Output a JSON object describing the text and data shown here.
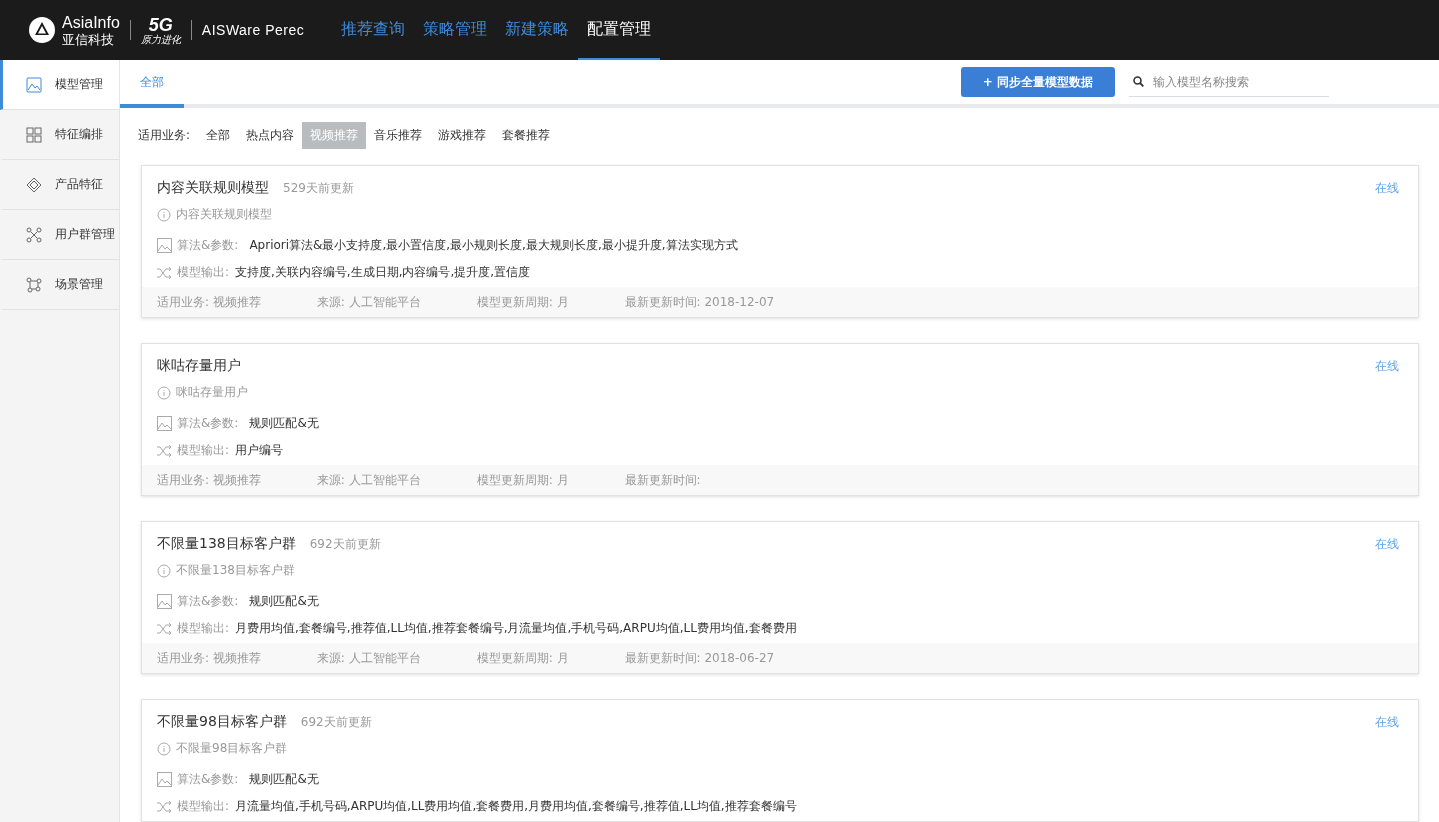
{
  "header": {
    "logo": {
      "brand": "AsiaInfo",
      "brand_cn": "亚信科技",
      "badge": "5G",
      "badge_sub": "原力进化",
      "product": "AISWare Perec"
    },
    "nav": [
      {
        "label": "推荐查询",
        "selected": false
      },
      {
        "label": "策略管理",
        "selected": false
      },
      {
        "label": "新建策略",
        "selected": false
      },
      {
        "label": "配置管理",
        "selected": true
      }
    ]
  },
  "sidebar": {
    "items": [
      {
        "label": "模型管理",
        "selected": true
      },
      {
        "label": "特征编排",
        "selected": false
      },
      {
        "label": "产品特征",
        "selected": false
      },
      {
        "label": "用户群管理",
        "selected": false
      },
      {
        "label": "场景管理",
        "selected": false
      }
    ]
  },
  "tabs": [
    {
      "label": "全部",
      "selected": true
    }
  ],
  "sync_button": "+ 同步全量模型数据",
  "search": {
    "placeholder": "输入模型名称搜索"
  },
  "filter": {
    "label": "适用业务:",
    "options": [
      {
        "label": "全部",
        "selected": false
      },
      {
        "label": "热点内容",
        "selected": false
      },
      {
        "label": "视频推荐",
        "selected": true
      },
      {
        "label": "音乐推荐",
        "selected": false
      },
      {
        "label": "游戏推荐",
        "selected": false
      },
      {
        "label": "套餐推荐",
        "selected": false
      }
    ]
  },
  "models": [
    {
      "title": "内容关联规则模型",
      "updated": "529天前更新",
      "status": "在线",
      "description": "内容关联规则模型",
      "algorithm_label": "算法&参数:",
      "algorithm": "Apriori算法&最小支持度,最小置信度,最小规则长度,最大规则长度,最小提升度,算法实现方式",
      "output_label": "模型输出:",
      "output": "支持度,关联内容编号,生成日期,内容编号,提升度,置信度",
      "footer": [
        "适用业务: 视频推荐",
        "来源: 人工智能平台",
        "模型更新周期: 月",
        "最新更新时间: 2018-12-07"
      ]
    },
    {
      "title": "咪咕存量用户",
      "status": "在线",
      "description": "咪咕存量用户",
      "algorithm_label": "算法&参数:",
      "algorithm": "规则匹配&无",
      "output_label": "模型输出:",
      "output": "用户编号",
      "footer": [
        "适用业务: 视频推荐",
        "来源: 人工智能平台",
        "模型更新周期: 月",
        "最新更新时间:"
      ]
    },
    {
      "title": "不限量138目标客户群",
      "updated": "692天前更新",
      "status": "在线",
      "description": "不限量138目标客户群",
      "algorithm_label": "算法&参数:",
      "algorithm": "规则匹配&无",
      "output_label": "模型输出:",
      "output": "月费用均值,套餐编号,推荐值,LL均值,推荐套餐编号,月流量均值,手机号码,ARPU均值,LL费用均值,套餐费用",
      "footer": [
        "适用业务: 视频推荐",
        "来源: 人工智能平台",
        "模型更新周期: 月",
        "最新更新时间: 2018-06-27"
      ]
    },
    {
      "title": "不限量98目标客户群",
      "updated": "692天前更新",
      "status": "在线",
      "description": "不限量98目标客户群",
      "algorithm_label": "算法&参数:",
      "algorithm": "规则匹配&无",
      "output_label": "模型输出:",
      "output": "月流量均值,手机号码,ARPU均值,LL费用均值,套餐费用,月费用均值,套餐编号,推荐值,LL均值,推荐套餐编号"
    }
  ]
}
